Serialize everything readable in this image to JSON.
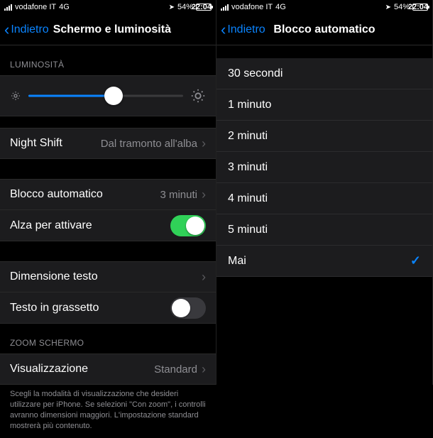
{
  "status": {
    "carrier": "vodafone IT",
    "network": "4G",
    "time": "22:04",
    "battery_pct": "54%"
  },
  "left": {
    "back": "Indietro",
    "title": "Schermo e luminosità",
    "brightness_header": "LUMINOSITÀ",
    "brightness_value": 0.55,
    "night_shift": {
      "label": "Night Shift",
      "value": "Dal tramonto all'alba"
    },
    "autolock": {
      "label": "Blocco automatico",
      "value": "3 minuti"
    },
    "raise": {
      "label": "Alza per attivare",
      "on": true
    },
    "textsize": {
      "label": "Dimensione testo"
    },
    "bold": {
      "label": "Testo in grassetto",
      "on": false
    },
    "zoom_header": "ZOOM SCHERMO",
    "view": {
      "label": "Visualizzazione",
      "value": "Standard"
    },
    "zoom_footer": "Scegli la modalità di visualizzazione che desideri utilizzare per iPhone. Se selezioni \"Con zoom\", i controlli avranno dimensioni maggiori. L'impostazione standard mostrerà più contenuto."
  },
  "right": {
    "back": "Indietro",
    "title": "Blocco automatico",
    "options": {
      "0": "30 secondi",
      "1": "1 minuto",
      "2": "2 minuti",
      "3": "3 minuti",
      "4": "4 minuti",
      "5": "5 minuti",
      "6": "Mai"
    },
    "selected": 6
  }
}
